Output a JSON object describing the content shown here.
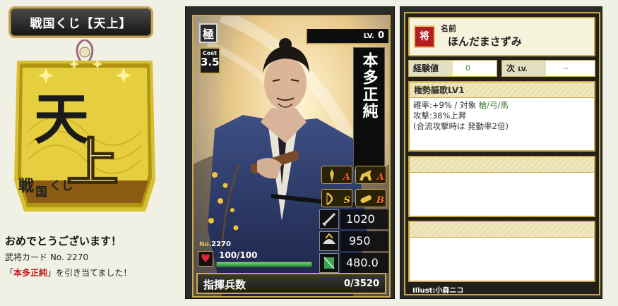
{
  "header": {
    "title": "戦国くじ【天上】"
  },
  "ticket": {
    "big_top": "天",
    "big_bottom": "上",
    "brand_a": "戦",
    "brand_b": "国",
    "brand_c": "くじ"
  },
  "result": {
    "congrats": "おめでとうございます！",
    "card_no_line": "武将カード No. 2270",
    "draw_prefix": "「",
    "draw_name": "本多正純",
    "draw_suffix": "」を引き当てました！"
  },
  "card": {
    "rarity": "極",
    "cost_label": "Cost",
    "cost": "3.5",
    "level_label": "LV.",
    "level": "0",
    "name": "本多正純",
    "skill_ranks": [
      "A",
      "A",
      "S",
      "B"
    ],
    "stats": {
      "attack": "1020",
      "defense": "950",
      "speed": "480.0"
    },
    "no_label": "No.",
    "no_value": "2270",
    "hp_text": "100/100",
    "hp_fraction": 1.0,
    "command_label": "指揮兵数",
    "command_value": "0/3520"
  },
  "info": {
    "seal_char": "将",
    "name_label": "名前",
    "name_value": "ほんだまさずみ",
    "exp_label": "経験値",
    "exp_value": "0",
    "next_label": "次",
    "next_lv_label": "LV.",
    "next_value": "--",
    "skill": {
      "title": "権勢謳歌LV1",
      "line1_a": "確率:+9%  /  対象 ",
      "line1_b": "槍/弓/馬",
      "line2": "攻撃:38%上昇",
      "line3": "(合流攻撃時は 発動率2倍)"
    },
    "illust": "Illust:小森ニコ"
  },
  "colors": {
    "gold": "#c9a94b",
    "accent_red": "#c3191b",
    "hp_green": "#2fa43a",
    "panel_dark": "#2b2b27"
  }
}
